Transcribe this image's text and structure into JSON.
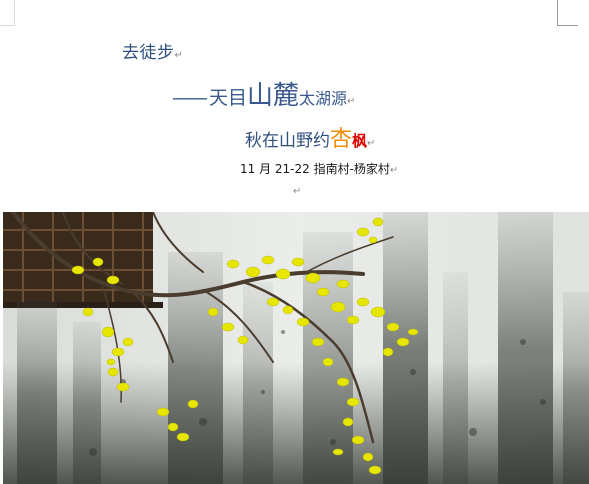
{
  "lines": {
    "line1": {
      "text": "去徒步"
    },
    "line2": {
      "dash": "——",
      "part1": "天目",
      "part2": "山麓",
      "part3": "太湖源"
    },
    "line3": {
      "part1": "秋在山野约",
      "part2": "杏",
      "part3": "枫"
    },
    "line4": {
      "text": "11 月 21-22 指南村-杨家村"
    }
  },
  "paragraph_mark": "↵",
  "colors": {
    "title_blue": "#2f4f7f",
    "accent_orange": "#f28c00",
    "accent_red": "#e00000",
    "leaf_yellow": "#e6e600"
  },
  "photo": {
    "subject": "ginkgo-branch-against-weathered-wall"
  }
}
